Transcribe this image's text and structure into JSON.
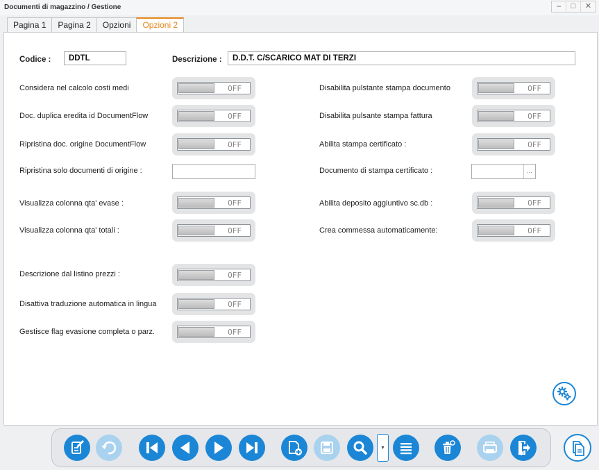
{
  "window": {
    "title": "Documenti di magazzino / Gestione",
    "controls": {
      "minimize": "–",
      "maximize": "□",
      "close": "✕"
    }
  },
  "tabs": [
    {
      "label": "Pagina 1",
      "active": false
    },
    {
      "label": "Pagina 2",
      "active": false
    },
    {
      "label": "Opzioni",
      "active": false
    },
    {
      "label": "Opzioni 2",
      "active": true
    }
  ],
  "form": {
    "codice_label": "Codice :",
    "codice_value": "DDTL",
    "descrizione_label": "Descrizione :",
    "descrizione_value": "D.D.T. C/SCARICO MAT DI TERZI"
  },
  "left_options": [
    {
      "label": "Considera nel calcolo costi medi",
      "state": "OFF"
    },
    {
      "label": "Doc. duplica eredita id DocumentFlow",
      "state": "OFF"
    },
    {
      "label": "Ripristina doc. origine DocumentFlow",
      "state": "OFF"
    },
    {
      "label": "Ripristina solo documenti di origine :",
      "value": ""
    },
    {
      "label": "Visualizza colonna qta' evase :",
      "state": "OFF"
    },
    {
      "label": "Visualizza colonna qta' totali :",
      "state": "OFF"
    },
    {
      "label": "Descrizione dal listino prezzi :",
      "state": "OFF"
    },
    {
      "label": "Disattiva traduzione automatica in lingua",
      "state": "OFF"
    },
    {
      "label": "Gestisce flag evasione completa o parz.",
      "state": "OFF"
    }
  ],
  "right_options": [
    {
      "label": "Disabilita pulstante stampa documento",
      "state": "OFF"
    },
    {
      "label": "Disabilita pulsante stampa fattura",
      "state": "OFF"
    },
    {
      "label": "Abilita stampa certificato :",
      "state": "OFF"
    },
    {
      "label": "Documento di stampa certificato :",
      "value": "",
      "button": "..."
    },
    {
      "label": "Abilita deposito aggiuntivo sc.db :",
      "state": "OFF"
    },
    {
      "label": "Crea commessa automaticamente:",
      "state": "OFF"
    }
  ],
  "toolbar": {
    "dropdown_glyph": "▾",
    "buttons": [
      {
        "icon": "edit-document-icon",
        "enabled": true
      },
      {
        "icon": "undo-icon",
        "enabled": false
      },
      {
        "icon": "first-record-icon",
        "enabled": true
      },
      {
        "icon": "previous-record-icon",
        "enabled": true
      },
      {
        "icon": "next-record-icon",
        "enabled": true
      },
      {
        "icon": "last-record-icon",
        "enabled": true
      },
      {
        "icon": "new-document-icon",
        "enabled": true
      },
      {
        "icon": "save-icon",
        "enabled": false
      },
      {
        "icon": "search-icon",
        "enabled": true
      },
      {
        "icon": "list-icon",
        "enabled": true
      },
      {
        "icon": "delete-icon",
        "enabled": true
      },
      {
        "icon": "print-icon",
        "enabled": false
      },
      {
        "icon": "exit-icon",
        "enabled": true
      }
    ]
  },
  "colors": {
    "accent": "#1b86d6",
    "accent_disabled": "#a9d2ef",
    "active_tab": "#e6861c"
  }
}
